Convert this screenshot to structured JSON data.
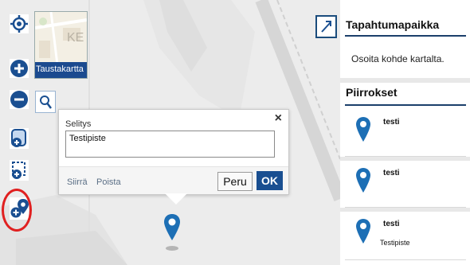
{
  "map": {
    "thumbnail_label": "Taustakartta",
    "thumbnail_text": "KE",
    "icons": [
      "locate-icon",
      "zoom-in-icon",
      "zoom-out-icon",
      "search-icon",
      "add-drawing-icon",
      "select-area-icon",
      "add-marker-icon",
      "expand-icon",
      "map-marker-icon"
    ]
  },
  "popup": {
    "caption": "Selitys",
    "close_label": "×",
    "value": "Testipiste",
    "move_label": "Siirrä",
    "delete_label": "Poista",
    "cancel_label": "Peru",
    "ok_label": "OK"
  },
  "panel": {
    "location_title": "Tapahtumapaikka",
    "location_text": "Osoita kohde kartalta.",
    "drawings_title": "Piirrokset",
    "drawings": [
      {
        "name": "testi",
        "description": ""
      },
      {
        "name": "testi",
        "description": ""
      },
      {
        "name": "testi",
        "description": "Testipiste"
      }
    ]
  },
  "colors": {
    "accent": "#1a4f91",
    "marker": "#1d6fb5",
    "highlight_circle": "#e02020"
  }
}
